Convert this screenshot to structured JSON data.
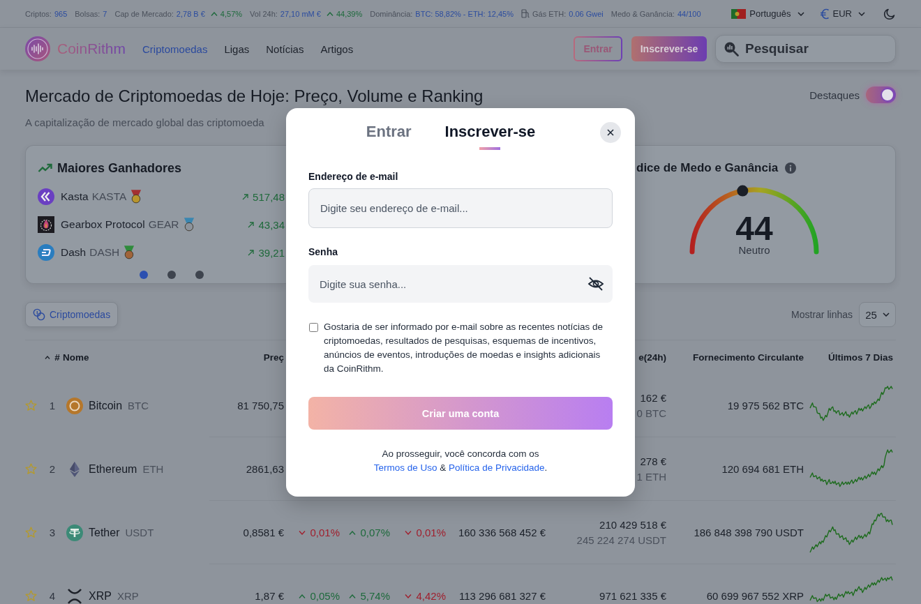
{
  "stats_bar": {
    "items": [
      {
        "kind": "plain",
        "label": "Criptos:",
        "value": "965"
      },
      {
        "kind": "plain",
        "label": "Bolsas:",
        "value": "7"
      },
      {
        "kind": "change",
        "label": "Cap de Mercado:",
        "value": "2,78 B €",
        "change": "4,57%",
        "rising": true
      },
      {
        "kind": "change",
        "label": "Vol 24h:",
        "value": "27,10 mM €",
        "change": "44,39%",
        "rising": true
      },
      {
        "kind": "plain",
        "label": "Dominância:",
        "value": "BTC: 58,82% - ETH: 12,45%"
      },
      {
        "kind": "gas",
        "label": "Gás ETH:",
        "value": "0.06 Gwei"
      },
      {
        "kind": "plain",
        "label": "Medo & Ganância:",
        "value": "44/100"
      }
    ],
    "language": "Português",
    "currency": "EUR"
  },
  "nav": {
    "brand": "CoinRithm",
    "links": [
      {
        "label": "Criptomoedas",
        "selected": true
      },
      {
        "label": "Ligas",
        "selected": false
      },
      {
        "label": "Notícias",
        "selected": false
      },
      {
        "label": "Artigos",
        "selected": false
      }
    ],
    "login": "Entrar",
    "signup": "Inscrever-se",
    "search": {
      "placeholder": "Pesquisar"
    }
  },
  "hero": {
    "title": "Mercado de Criptomoedas de Hoje: Preço, Volume e Ranking",
    "subtitle": "A capitalização de mercado global das criptomoeda",
    "highlights": {
      "label": "Destaques",
      "on": true
    }
  },
  "gainers": {
    "title": "Maiores Ganhadores",
    "items": [
      {
        "name": "Kasta",
        "symbol": "KASTA",
        "change": "517,48"
      },
      {
        "name": "Gearbox Protocol",
        "symbol": "GEAR",
        "change": "43,34"
      },
      {
        "name": "Dash",
        "symbol": "DASH",
        "change": "39,21"
      }
    ],
    "pages": [
      {
        "selected": true
      },
      {
        "selected": false
      },
      {
        "selected": false
      }
    ]
  },
  "fear_greed": {
    "title": "dice de Medo e Ganância",
    "value": "44",
    "label": "Neutro",
    "level": 0.44
  },
  "table": {
    "filter": "Criptomoedas",
    "rows_label": "Mostrar linhas",
    "rows_value": "25",
    "columns": [
      {
        "kind": "rank",
        "label": "#",
        "sorted": true
      },
      {
        "kind": "name",
        "label": "Nome",
        "sorted": false
      },
      {
        "kind": "price",
        "label": "Preç",
        "sorted": false
      },
      {
        "kind": "volume",
        "label": "e(24h)",
        "sorted": false
      },
      {
        "kind": "supply",
        "label": "Fornecimento Circulante",
        "sorted": false
      },
      {
        "kind": "chart",
        "label": "Últimos 7 Dias",
        "sorted": false
      }
    ],
    "rows": [
      {
        "favorite": false,
        "rank": "1",
        "name": "Bitcoin",
        "symbol": "BTC",
        "price": "81 750,75",
        "volume": "162 €",
        "volume_coin": "0 BTC",
        "supply": "19 975 562 BTC"
      },
      {
        "favorite": false,
        "rank": "2",
        "name": "Ethereum",
        "symbol": "ETH",
        "price": "2861,63",
        "volume": "278 €",
        "volume_coin": "1 ETH",
        "supply": "120 694 681 ETH"
      },
      {
        "favorite": false,
        "rank": "3",
        "name": "Tether",
        "symbol": "USDT",
        "price": "0,8581 €",
        "changes": [
          {
            "value": "0,01%",
            "rising": false
          },
          {
            "value": "0,07%",
            "rising": true
          },
          {
            "value": "0,01%",
            "rising": false
          }
        ],
        "market_cap": "160 336 568 452 €",
        "volume": "210 429 518 €",
        "volume_coin": "245 224 274 USDT",
        "supply": "186 848 398 790 USDT"
      },
      {
        "favorite": false,
        "rank": "4",
        "name": "XRP",
        "symbol": "XRP",
        "price": "1,87 €",
        "changes": [
          {
            "value": "0,05%",
            "rising": true
          },
          {
            "value": "5,74%",
            "rising": true
          },
          {
            "value": "4,42%",
            "rising": false
          }
        ],
        "market_cap": "113 296 681 327 €",
        "volume": "971 621 335 €",
        "supply": "60 699 967 552 XRP"
      }
    ]
  },
  "modal": {
    "tabs": [
      {
        "label": "Entrar",
        "selected": false
      },
      {
        "label": "Inscrever-se",
        "selected": true
      }
    ],
    "email": {
      "label": "Endereço de e-mail",
      "placeholder": "Digite seu endereço de e-mail..."
    },
    "password": {
      "label": "Senha",
      "placeholder": "Digite sua senha..."
    },
    "newsletter": {
      "checked": false,
      "label": "Gostaria de ser informado por e-mail sobre as recentes notícias de criptomoedas, resultados de pesquisas, esquemas de incentivos, anúncios de eventos, introduções de moedas e insights adicionais da CoinRithm."
    },
    "submit": "Criar uma conta",
    "legal": {
      "before": "Ao prosseguir, você concorda com os",
      "terms": "Termos de Uso",
      "joiner": "&",
      "privacy": "Política de Privacidade",
      "after": "."
    }
  }
}
